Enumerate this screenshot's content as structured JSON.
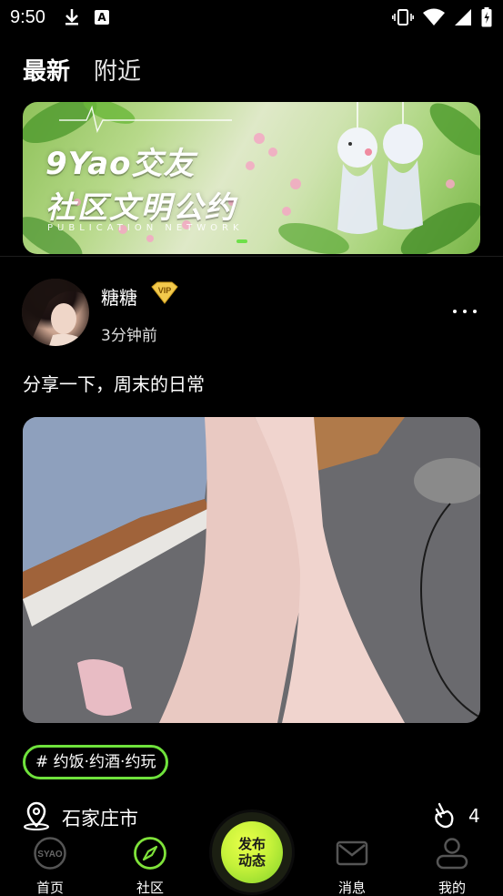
{
  "status_bar": {
    "time": "9:50",
    "notification_icons": [
      "download-icon",
      "a-icon"
    ],
    "system_icons": [
      "vibrate-icon",
      "wifi-icon",
      "signal-icon",
      "battery-icon"
    ]
  },
  "tabs": [
    {
      "label": "最新",
      "active": true
    },
    {
      "label": "附近",
      "active": false
    }
  ],
  "banner": {
    "title": "9Yao交友",
    "subtitle": "社区文明公约",
    "caption": "PUBLICATION NETWORK"
  },
  "post": {
    "username": "糖糖",
    "vip_badge": "VIP",
    "time_ago": "3分钟前",
    "text": "分享一下，周末的日常",
    "tag": "# 约饭·约酒·约玩",
    "location": "石家庄市",
    "like_count": "4"
  },
  "nav": {
    "home": "首页",
    "community": "社区",
    "publish": "发布动态",
    "messages": "消息",
    "mine": "我的"
  },
  "colors": {
    "accent": "#6fe23c",
    "publish_yellow": "#d8f53c",
    "background": "#000000"
  }
}
